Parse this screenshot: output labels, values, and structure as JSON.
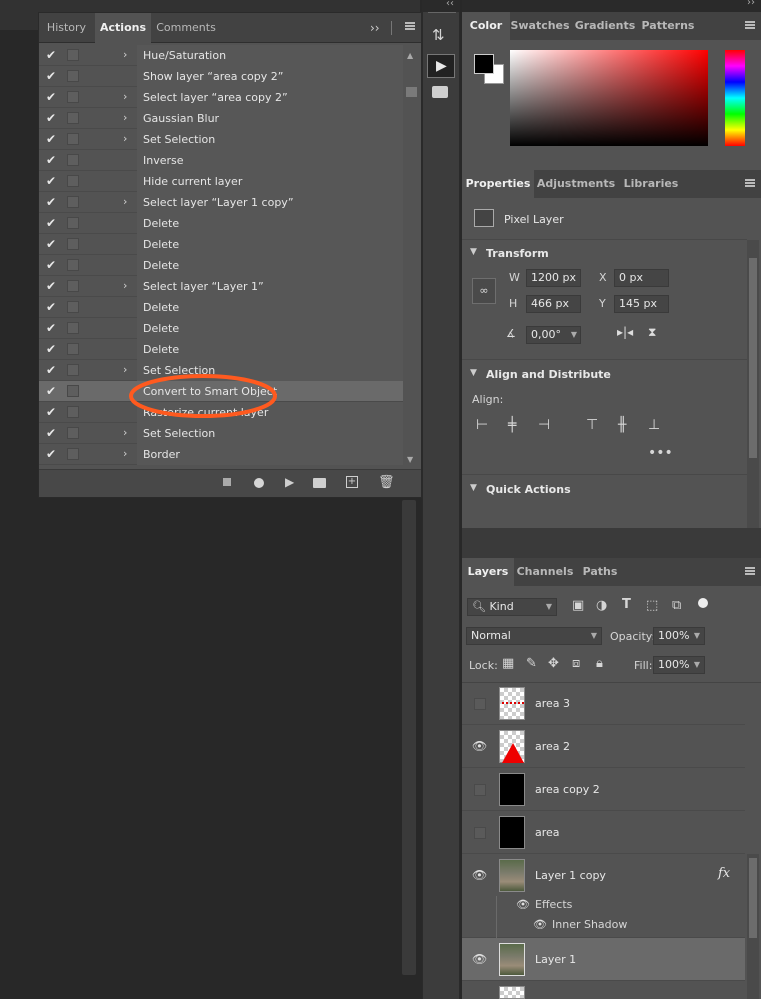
{
  "actions_panel": {
    "tabs": [
      "History",
      "Actions",
      "Comments"
    ],
    "rows": [
      {
        "label": "Hue/Saturation",
        "expand": true
      },
      {
        "label": "Show layer “area copy 2”",
        "expand": false
      },
      {
        "label": "Select layer “area copy 2”",
        "expand": true
      },
      {
        "label": "Gaussian Blur",
        "expand": true
      },
      {
        "label": "Set Selection",
        "expand": true
      },
      {
        "label": "Inverse",
        "expand": false
      },
      {
        "label": "Hide current layer",
        "expand": false
      },
      {
        "label": "Select layer “Layer 1 copy”",
        "expand": true
      },
      {
        "label": "Delete",
        "expand": false
      },
      {
        "label": "Delete",
        "expand": false
      },
      {
        "label": "Delete",
        "expand": false
      },
      {
        "label": "Select layer “Layer 1”",
        "expand": true
      },
      {
        "label": "Delete",
        "expand": false
      },
      {
        "label": "Delete",
        "expand": false
      },
      {
        "label": "Delete",
        "expand": false
      },
      {
        "label": "Set Selection",
        "expand": true
      },
      {
        "label": "Convert to Smart Object",
        "expand": false,
        "selected": true
      },
      {
        "label": "Rasterize current layer",
        "expand": false
      },
      {
        "label": "Set Selection",
        "expand": true
      },
      {
        "label": "Border",
        "expand": true
      }
    ],
    "annotation_color": "#ff5a1f"
  },
  "color_panel": {
    "tabs": [
      "Color",
      "Swatches",
      "Gradients",
      "Patterns"
    ],
    "hue_color": "#ff0000"
  },
  "properties_panel": {
    "tabs": [
      "Properties",
      "Adjustments",
      "Libraries"
    ],
    "layer_type": "Pixel Layer",
    "transform_title": "Transform",
    "w_label": "W",
    "w_value": "1200 px",
    "h_label": "H",
    "h_value": "466 px",
    "x_label": "X",
    "x_value": "0 px",
    "y_label": "Y",
    "y_value": "145 px",
    "angle_value": "0,00°",
    "align_title": "Align and Distribute",
    "align_label": "Align:",
    "quick_actions_title": "Quick Actions"
  },
  "layers_panel": {
    "tabs": [
      "Layers",
      "Channels",
      "Paths"
    ],
    "filter_kind": "Kind",
    "blend_mode": "Normal",
    "opacity_label": "Opacity:",
    "opacity_value": "100%",
    "lock_label": "Lock:",
    "fill_label": "Fill:",
    "fill_value": "100%",
    "layers": [
      {
        "name": "area 3",
        "visible": false,
        "thumb": "checker-red-dots"
      },
      {
        "name": "area 2",
        "visible": true,
        "thumb": "checker-red-triangle"
      },
      {
        "name": "area copy 2",
        "visible": false,
        "thumb": "black"
      },
      {
        "name": "area",
        "visible": false,
        "thumb": "black"
      },
      {
        "name": "Layer 1 copy",
        "visible": true,
        "thumb": "photo",
        "fx": "fx"
      },
      {
        "name": "Layer 1",
        "visible": true,
        "thumb": "photo",
        "selected": true
      }
    ],
    "effects_label": "Effects",
    "inner_shadow_label": "Inner Shadow"
  }
}
